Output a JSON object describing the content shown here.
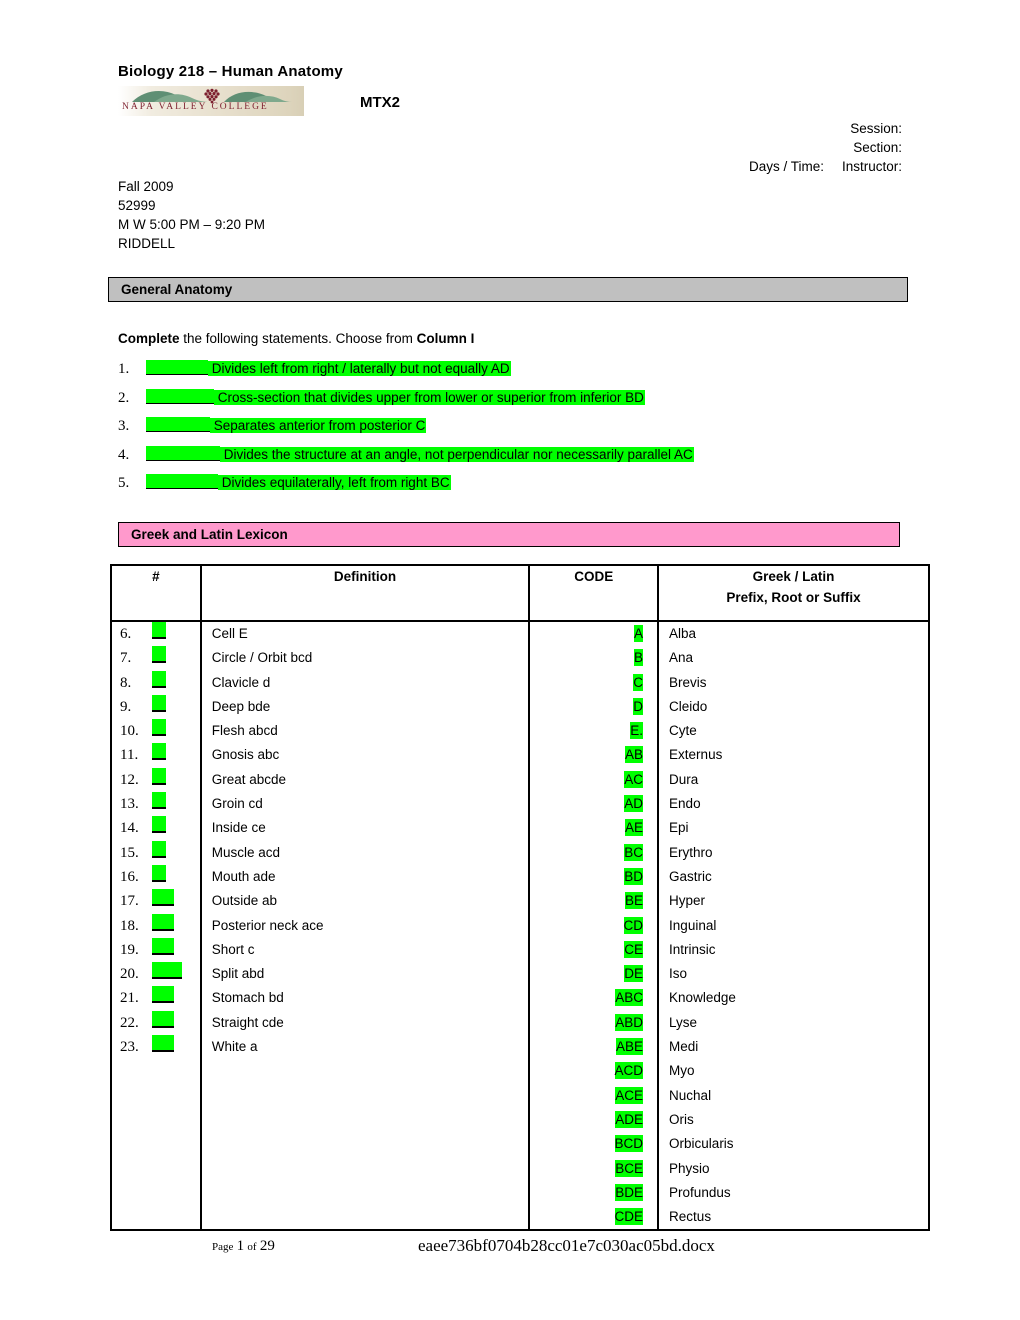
{
  "header": {
    "course_title": "Biology 218 – Human Anatomy",
    "exam_code": "MTX2",
    "logo_text": "NAPA VALLEY COLLEGE",
    "logo_alt": "napa-valley-college-logo",
    "labels": {
      "session": "Session:",
      "section": "Section:",
      "days_time": "Days  / Time:",
      "instructor": "Instructor:"
    },
    "values": {
      "session": "Fall 2009",
      "section": "52999",
      "days_time": "M W   5:00 PM – 9:20 PM",
      "instructor": "RIDDELL"
    }
  },
  "sections": {
    "general_anatomy": {
      "title": "General Anatomy",
      "bar_color": "#c0c0c0"
    },
    "lexicon": {
      "title": "Greek and Latin Lexicon",
      "bar_color": "#ff99cc"
    }
  },
  "instruction": {
    "bold_lead": "Complete",
    "middle": " the following statements. Choose from ",
    "bold_tail": "Column I"
  },
  "questions": [
    {
      "num": "1.",
      "blank_width": 62,
      "text": "Divides left from right / laterally but not equally  AD"
    },
    {
      "num": "2.",
      "blank_width": 68,
      "text": "Cross-section that divides upper from lower or superior from inferior   BD"
    },
    {
      "num": "3.",
      "blank_width": 64,
      "text": "Separates anterior from posterior   C"
    },
    {
      "num": "4.",
      "blank_width": 74,
      "text": "Divides the structure at an angle, not perpendicular nor necessarily parallel  AC"
    },
    {
      "num": "5.",
      "blank_width": 72,
      "text": "Divides equilaterally, left from right  BC"
    }
  ],
  "table": {
    "headers": {
      "num": "#",
      "definition": "Definition",
      "code": "CODE",
      "greek_latin_line1": "Greek / Latin",
      "greek_latin_line2": "Prefix, Root or Suffix"
    },
    "numbers": [
      {
        "label": "6.",
        "blank_width": 14
      },
      {
        "label": "7.",
        "blank_width": 14
      },
      {
        "label": "8.",
        "blank_width": 14
      },
      {
        "label": "9.",
        "blank_width": 14
      },
      {
        "label": "10.",
        "blank_width": 14
      },
      {
        "label": "11.",
        "blank_width": 14
      },
      {
        "label": "12.",
        "blank_width": 14
      },
      {
        "label": "13.",
        "blank_width": 14
      },
      {
        "label": "14.",
        "blank_width": 14
      },
      {
        "label": "15.",
        "blank_width": 14
      },
      {
        "label": "16.",
        "blank_width": 14
      },
      {
        "label": "17.",
        "blank_width": 22
      },
      {
        "label": "18.",
        "blank_width": 22
      },
      {
        "label": "19.",
        "blank_width": 22
      },
      {
        "label": "20.",
        "blank_width": 30
      },
      {
        "label": "21.",
        "blank_width": 22
      },
      {
        "label": "22.",
        "blank_width": 22
      },
      {
        "label": "23.",
        "blank_width": 22
      }
    ],
    "definitions": [
      "Cell  E",
      "Circle / Orbit   bcd",
      "Clavicle   d",
      "Deep  bde",
      "Flesh abcd",
      "Gnosis  abc",
      "Great   abcde",
      "Groin  cd",
      "Inside  ce",
      "Muscle acd",
      "Mouth  ade",
      "Outside  ab",
      "Posterior neck  ace",
      "Short  c",
      "Split abd",
      "Stomach  bd",
      "Straight  cde",
      "White a"
    ],
    "codes": [
      "A",
      "B",
      "C",
      "D",
      "E.",
      "AB",
      "AC",
      "AD",
      "AE",
      "BC",
      "BD",
      "BE",
      "CD",
      "CE",
      "DE",
      "ABC",
      "ABD ",
      "ABE",
      "ACD",
      "ACE",
      "ADE",
      "BCD",
      "BCE",
      "BDE",
      "CDE"
    ],
    "greek_latin": [
      "Alba",
      "Ana",
      "Brevis",
      "Cleido",
      "Cyte",
      "Externus",
      "Dura",
      "Endo",
      "Epi",
      "Erythro",
      "Gastric",
      "Hyper",
      "Inguinal",
      "Intrinsic",
      "Iso",
      "Knowledge",
      "Lyse",
      "Medi",
      "Myo",
      "Nuchal",
      "Oris",
      "Orbicularis",
      "Physio",
      "Profundus",
      "Rectus"
    ]
  },
  "footer": {
    "page_label": "Page",
    "page_number": "1",
    "of_label": "of",
    "page_total": "29",
    "filename": "eaee736bf0704b28cc01e7c030ac05bd.docx"
  },
  "colors": {
    "highlight_green": "#00ff00",
    "section_gray": "#c0c0c0",
    "section_pink": "#ff99cc",
    "logo_maroon": "#7d1f2e",
    "logo_green": "#5f8f74"
  }
}
